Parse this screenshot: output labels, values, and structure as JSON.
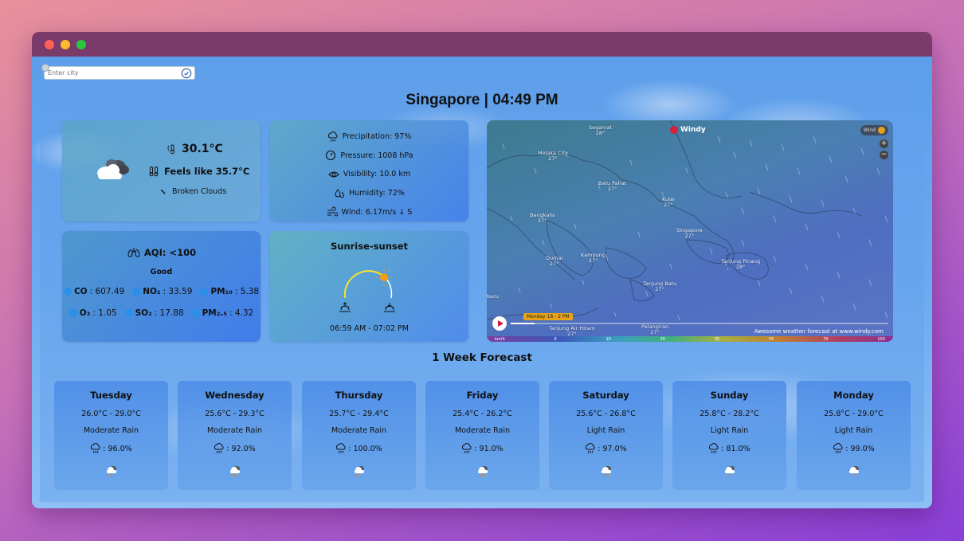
{
  "search": {
    "placeholder": "Enter city"
  },
  "header": {
    "title": "Singapore | 04:49 PM"
  },
  "current": {
    "temperature": "30.1°C",
    "feels_like": "Feels like 35.7°C",
    "description": "Broken Clouds"
  },
  "stats": [
    {
      "icon": "rain-cloud-icon",
      "text": "Precipitation: 97%"
    },
    {
      "icon": "gauge-icon",
      "text": "Pressure: 1008 hPa"
    },
    {
      "icon": "eye-icon",
      "text": "Visibility: 10.0 km"
    },
    {
      "icon": "droplets-icon",
      "text": "Humidity: 72%"
    },
    {
      "icon": "wind-icon",
      "text": "Wind: 6.17m/s ↓ S"
    }
  ],
  "aqi": {
    "title": "AQI: <100",
    "label": "Good",
    "pollutants": [
      {
        "name": "CO",
        "value": ": 607.49"
      },
      {
        "name": "NO₂",
        "value": ": 33.59"
      },
      {
        "name": "PM₁₀",
        "value": ": 5.38"
      },
      {
        "name": "O₃",
        "value": ": 1.05"
      },
      {
        "name": "SO₂",
        "value": ": 17.88"
      },
      {
        "name": "PM₂.₅",
        "value": ": 4.32"
      }
    ]
  },
  "sun": {
    "title": "Sunrise-sunset",
    "times": "06:59 AM - 07:02 PM"
  },
  "map": {
    "brand": "Windy",
    "layer": "Wind",
    "time_tag": "Monday 18 - 2 PM",
    "credit": "Awesome weather forecast at www.windy.com",
    "scale": [
      "km/h",
      "0",
      "10",
      "20",
      "35",
      "55",
      "70",
      "100"
    ],
    "places": [
      {
        "name": "Segamat",
        "temp": "28°"
      },
      {
        "name": "Melaka City",
        "temp": "27°"
      },
      {
        "name": "Batu Pahat",
        "temp": "27°"
      },
      {
        "name": "Kulai",
        "temp": "27°"
      },
      {
        "name": "Bengkalis",
        "temp": "27°"
      },
      {
        "name": "Singapore",
        "temp": "27°"
      },
      {
        "name": "Dumai",
        "temp": "27°"
      },
      {
        "name": "Kampung",
        "temp": "27°"
      },
      {
        "name": "Tanjung Pinang",
        "temp": "28°"
      },
      {
        "name": "Tanjung Batu",
        "temp": "27°"
      },
      {
        "name": "Tanjung Air Hitam",
        "temp": "27°"
      },
      {
        "name": "Pelangiran",
        "temp": "27°"
      },
      {
        "name": "baru",
        "temp": ""
      }
    ]
  },
  "forecast": {
    "title": "1 Week Forecast",
    "days": [
      {
        "day": "Tuesday",
        "range": "26.0°C - 29.0°C",
        "desc": "Moderate Rain",
        "prec": ": 96.0%"
      },
      {
        "day": "Wednesday",
        "range": "25.6°C - 29.3°C",
        "desc": "Moderate Rain",
        "prec": ": 92.0%"
      },
      {
        "day": "Thursday",
        "range": "25.7°C - 29.4°C",
        "desc": "Moderate Rain",
        "prec": ": 100.0%"
      },
      {
        "day": "Friday",
        "range": "25.4°C - 26.2°C",
        "desc": "Moderate Rain",
        "prec": ": 91.0%"
      },
      {
        "day": "Saturday",
        "range": "25.6°C - 26.8°C",
        "desc": "Light Rain",
        "prec": ": 97.0%"
      },
      {
        "day": "Sunday",
        "range": "25.8°C - 28.2°C",
        "desc": "Light Rain",
        "prec": ": 81.0%"
      },
      {
        "day": "Monday",
        "range": "25.8°C - 29.0°C",
        "desc": "Light Rain",
        "prec": ": 99.0%"
      }
    ]
  }
}
